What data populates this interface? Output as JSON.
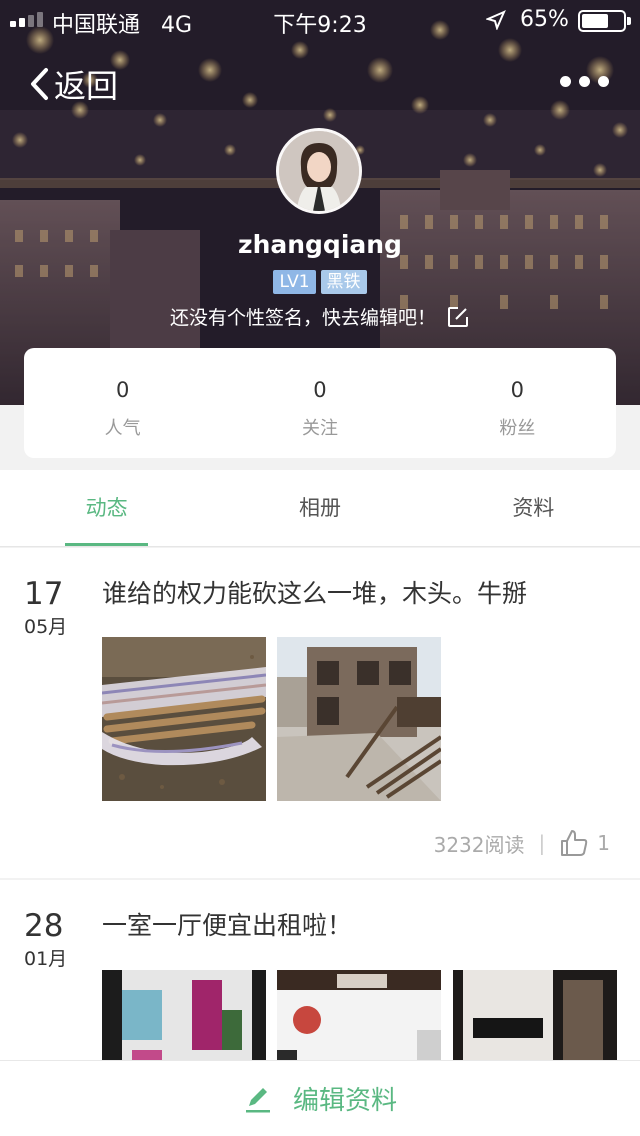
{
  "status_bar": {
    "carrier": "中国联通",
    "network": "4G",
    "time": "下午9:23",
    "battery": "65%"
  },
  "nav": {
    "back_label": "返回"
  },
  "profile": {
    "username": "zhangqiang",
    "level": "LV1",
    "rank": "黑铁",
    "signature": "还没有个性签名，快去编辑吧！"
  },
  "stats": [
    {
      "value": "0",
      "label": "人气"
    },
    {
      "value": "0",
      "label": "关注"
    },
    {
      "value": "0",
      "label": "粉丝"
    }
  ],
  "tabs": [
    {
      "label": "动态",
      "active": true
    },
    {
      "label": "相册",
      "active": false
    },
    {
      "label": "资料",
      "active": false
    }
  ],
  "posts": [
    {
      "day": "17",
      "month": "05月",
      "text": "谁给的权力能砍这么一堆，木头。牛掰",
      "reads": "3232阅读",
      "likes": "1"
    },
    {
      "day": "28",
      "month": "01月",
      "text": "一室一厅便宜出租啦！"
    }
  ],
  "bottom": {
    "edit_label": "编辑资料"
  },
  "colors": {
    "accent": "#5ab882",
    "badge": "#8fb7e6"
  }
}
